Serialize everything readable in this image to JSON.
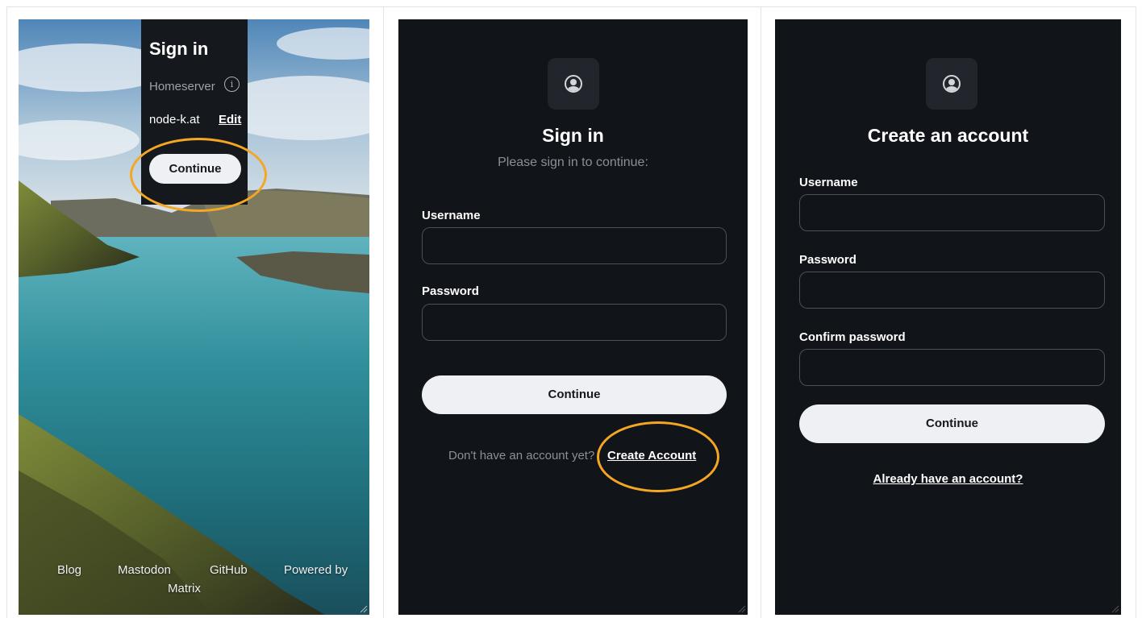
{
  "colors": {
    "accent_highlight": "#f5a623",
    "panel_dark": "#111418",
    "button_bg": "#eef0f3",
    "muted_text": "#8a9099"
  },
  "panel_landscape": {
    "card": {
      "title": "Sign in",
      "homeserver_label": "Homeserver",
      "info_icon": "info-icon",
      "server_name": "node-k.at",
      "edit_label": "Edit",
      "continue_label": "Continue"
    },
    "footer": {
      "blog": "Blog",
      "mastodon": "Mastodon",
      "github": "GitHub",
      "powered_by": "Powered by",
      "matrix": "Matrix"
    }
  },
  "panel_signin": {
    "avatar_icon": "user-circle-icon",
    "title": "Sign in",
    "subtitle": "Please sign in to continue:",
    "username_label": "Username",
    "username_value": "",
    "password_label": "Password",
    "password_value": "",
    "continue_label": "Continue",
    "no_account_text": "Don't have an account yet?",
    "create_account_label": "Create Account"
  },
  "panel_register": {
    "avatar_icon": "user-circle-icon",
    "title": "Create an account",
    "username_label": "Username",
    "username_value": "",
    "password_label": "Password",
    "password_value": "",
    "confirm_label": "Confirm password",
    "confirm_value": "",
    "continue_label": "Continue",
    "already_label": "Already have an account?"
  }
}
